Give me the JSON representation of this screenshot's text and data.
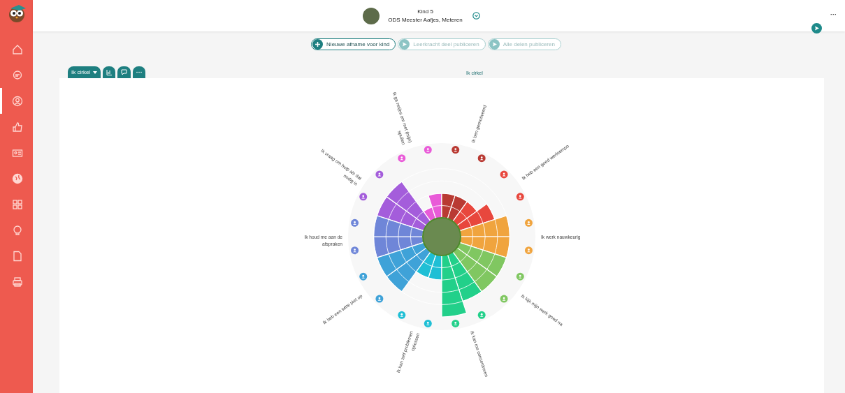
{
  "sidebar": {
    "items": [
      {
        "kind": "home",
        "selected": false
      },
      {
        "kind": "chat",
        "selected": false
      },
      {
        "kind": "user",
        "selected": true
      },
      {
        "kind": "thumb",
        "selected": false
      },
      {
        "kind": "card",
        "selected": false
      },
      {
        "kind": "globe",
        "selected": false
      },
      {
        "kind": "grid",
        "selected": false
      },
      {
        "kind": "bulb",
        "selected": false
      },
      {
        "kind": "doc",
        "selected": false
      },
      {
        "kind": "print",
        "selected": false
      }
    ]
  },
  "header": {
    "name": "Kind 5",
    "school": "ODS Meester Aafjes, Meteren",
    "menu": "···"
  },
  "actions": [
    {
      "kind": "add",
      "label": "Nieuwe afname voor kind",
      "disabled": false
    },
    {
      "kind": "publish",
      "label": "Leerkracht deel publiceren",
      "disabled": true
    },
    {
      "kind": "publish",
      "label": "Alle delen publiceren",
      "disabled": true
    }
  ],
  "tabs": [
    {
      "kind": "dropdown",
      "label": "Ik cirkel"
    },
    {
      "kind": "chart"
    },
    {
      "kind": "comment"
    },
    {
      "kind": "more"
    }
  ],
  "view_title": "Ik cirkel",
  "items": [
    {
      "label": [
        "Ik ga netjes om met (mijn)",
        "spullen"
      ],
      "color": "#e95bd8"
    },
    {
      "label": [
        "Ik ben gemotiveerd"
      ],
      "color": "#b93a33"
    },
    {
      "label": [
        "Ik heb een goed werktempo"
      ],
      "color": "#e8473d"
    },
    {
      "label": [
        "Ik vraag om hulp als dat",
        "nodig is"
      ],
      "color": "#a45ddb"
    },
    {
      "label": [
        "Ik houd me aan de",
        "afspraken"
      ],
      "color": "#6f86d8"
    },
    {
      "label": [
        "Ik werk nauwkeurig"
      ],
      "color": "#f0a43e"
    },
    {
      "label": [
        "Ik kijk mijn werk goed na"
      ],
      "color": "#80c761"
    },
    {
      "label": [
        "Ik heb een witte piet op"
      ],
      "color": "#3fa2d8"
    },
    {
      "label": [
        "Ik kan zelf problemen",
        "oplossen"
      ],
      "color": "#1fbfd5"
    },
    {
      "label": [
        "Ik kan me concentreren"
      ],
      "color": "#22d08a"
    }
  ]
}
